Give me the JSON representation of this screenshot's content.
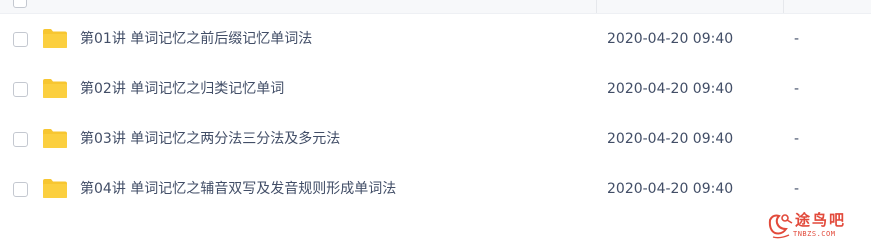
{
  "files": [
    {
      "name": "第01讲 单词记忆之前后缀记忆单词法",
      "modified": "2020-04-20 09:40",
      "size": "-"
    },
    {
      "name": "第02讲 单词记忆之归类记忆单词",
      "modified": "2020-04-20 09:40",
      "size": "-"
    },
    {
      "name": "第03讲 单词记忆之两分法三分法及多元法",
      "modified": "2020-04-20 09:40",
      "size": "-"
    },
    {
      "name": "第04讲 单词记忆之辅音双写及发音规则形成单词法",
      "modified": "2020-04-20 09:40",
      "size": "-"
    }
  ],
  "icons": {
    "folder": "folder-icon",
    "checkbox": "checkbox-icon"
  },
  "watermark": {
    "text_cn": "途鸟吧",
    "text_en": "TNBZS.COM",
    "color": "#e24a3b"
  },
  "colors": {
    "folder": "#f7c631",
    "text": "#424e67"
  }
}
